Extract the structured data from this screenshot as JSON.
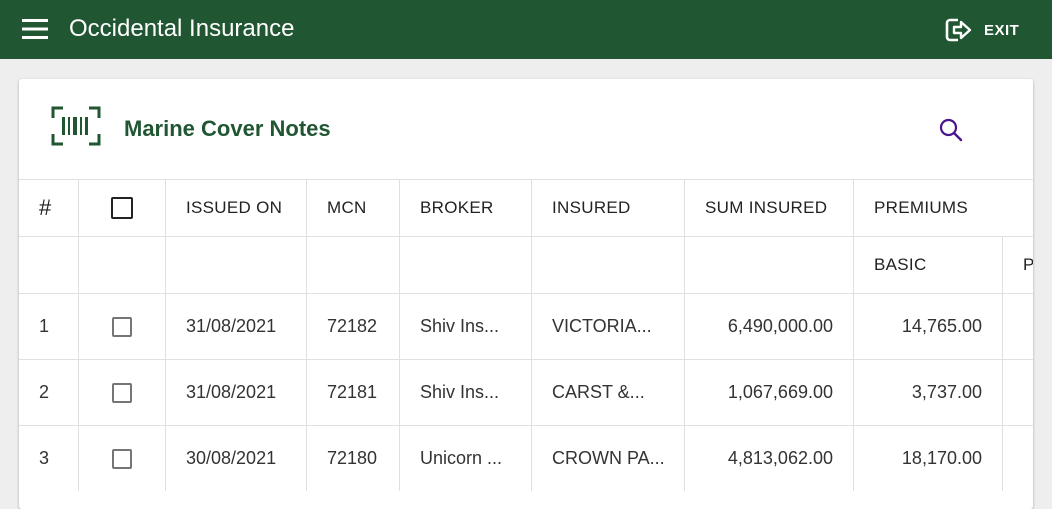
{
  "appbar": {
    "title": "Occidental Insurance",
    "exit_label": "EXIT",
    "color": "#205632"
  },
  "card": {
    "title": "Marine Cover Notes"
  },
  "table": {
    "headers": {
      "num": "#",
      "issued_on": "ISSUED ON",
      "mcn": "MCN",
      "broker": "BROKER",
      "insured": "INSURED",
      "sum_insured": "SUM INSURED",
      "premiums": "PREMIUMS"
    },
    "subheaders": {
      "basic": "BASIC",
      "next": "P"
    },
    "rows": [
      {
        "num": "1",
        "issued_on": "31/08/2021",
        "mcn": "72182",
        "broker": "Shiv Ins...",
        "insured": "VICTORIA...",
        "sum_insured": "6,490,000.00",
        "basic": "14,765.00"
      },
      {
        "num": "2",
        "issued_on": "31/08/2021",
        "mcn": "72181",
        "broker": "Shiv Ins...",
        "insured": "CARST &...",
        "sum_insured": "1,067,669.00",
        "basic": "3,737.00"
      },
      {
        "num": "3",
        "issued_on": "30/08/2021",
        "mcn": "72180",
        "broker": "Unicorn ...",
        "insured": "CROWN PA...",
        "sum_insured": "4,813,062.00",
        "basic": "18,170.00"
      }
    ]
  }
}
